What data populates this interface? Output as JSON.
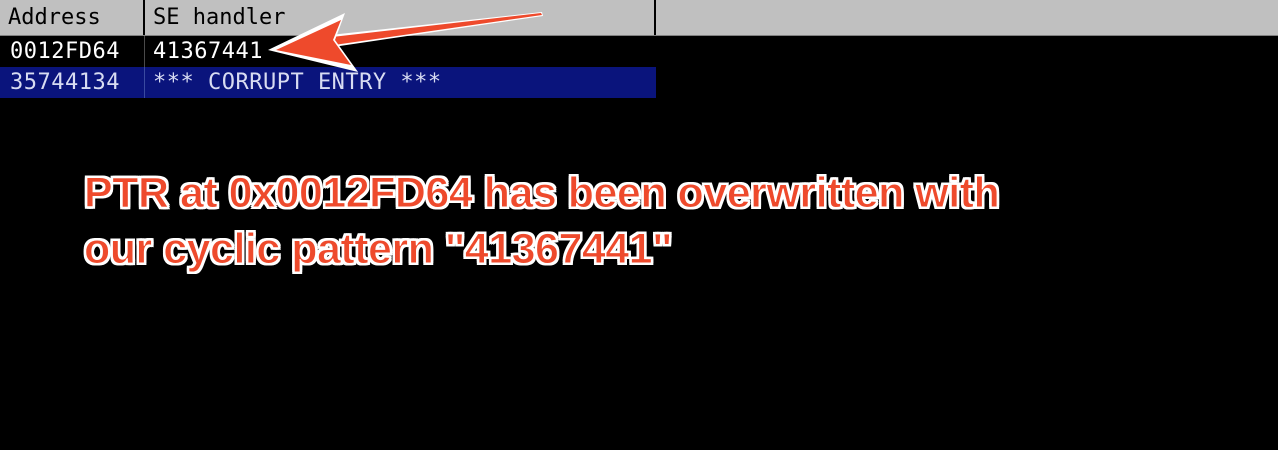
{
  "seh_window": {
    "columns": {
      "address": "Address",
      "handler": "SE handler"
    },
    "rows": [
      {
        "address": "0012FD64",
        "handler": "41367441",
        "selected": false
      },
      {
        "address": "35744134",
        "handler": "*** CORRUPT ENTRY ***",
        "selected": true
      }
    ]
  },
  "annotation": {
    "line1": "PTR at 0x0012FD64 has been overwritten with",
    "line2": "our cyclic pattern \"41367441\"",
    "color": "#ee4a2c",
    "outline_color": "#ffffff"
  },
  "arrow": {
    "color": "#ee4a2c",
    "points_to": "41367441"
  },
  "colors": {
    "background": "#000000",
    "header_bg": "#c0c0c0",
    "selected_row_bg": "#0a147c"
  }
}
